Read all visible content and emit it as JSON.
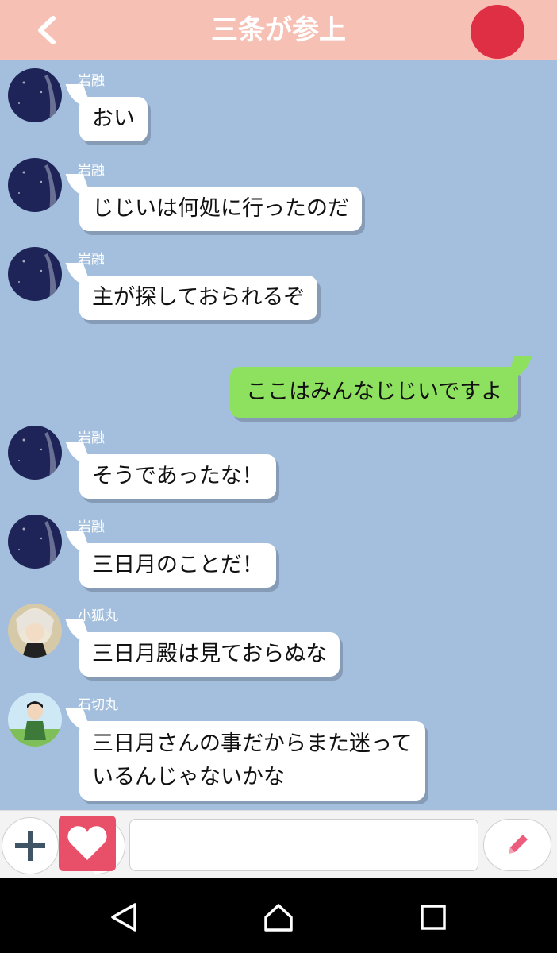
{
  "header": {
    "title": "三条が参上",
    "back_icon": "chevron-left-icon",
    "record_color": "#df2f44",
    "background": "#f7c0b5"
  },
  "messages": [
    {
      "sender": "岩融",
      "text": "おい",
      "avatar": "night-sky-avatar"
    },
    {
      "sender": "岩融",
      "text": "じじいは何処に行ったのだ",
      "avatar": "night-sky-avatar"
    },
    {
      "sender": "岩融",
      "text": "主が探しておられるぞ",
      "avatar": "night-sky-avatar"
    },
    {
      "sender": "",
      "text": "ここはみんなじじいですよ",
      "self": true
    },
    {
      "sender": "岩融",
      "text": "そうであったな！",
      "avatar": "night-sky-avatar"
    },
    {
      "sender": "岩融",
      "text": "三日月のことだ！",
      "avatar": "night-sky-avatar"
    },
    {
      "sender": "小狐丸",
      "text": "三日月殿は見ておらぬな",
      "avatar": "white-haired-avatar"
    },
    {
      "sender": "石切丸",
      "text": "三日月さんの事だからまた迷って",
      "text2": "いるんじゃないかな",
      "avatar": "green-field-avatar"
    }
  ],
  "composer": {
    "plus_icon": "plus-icon",
    "heart_icon": "heart-icon",
    "input_value": "",
    "input_placeholder": "",
    "edit_icon": "pencil-icon"
  },
  "navbar": {
    "back_icon": "triangle-back-icon",
    "home_icon": "home-icon",
    "recents_icon": "square-recents-icon"
  }
}
